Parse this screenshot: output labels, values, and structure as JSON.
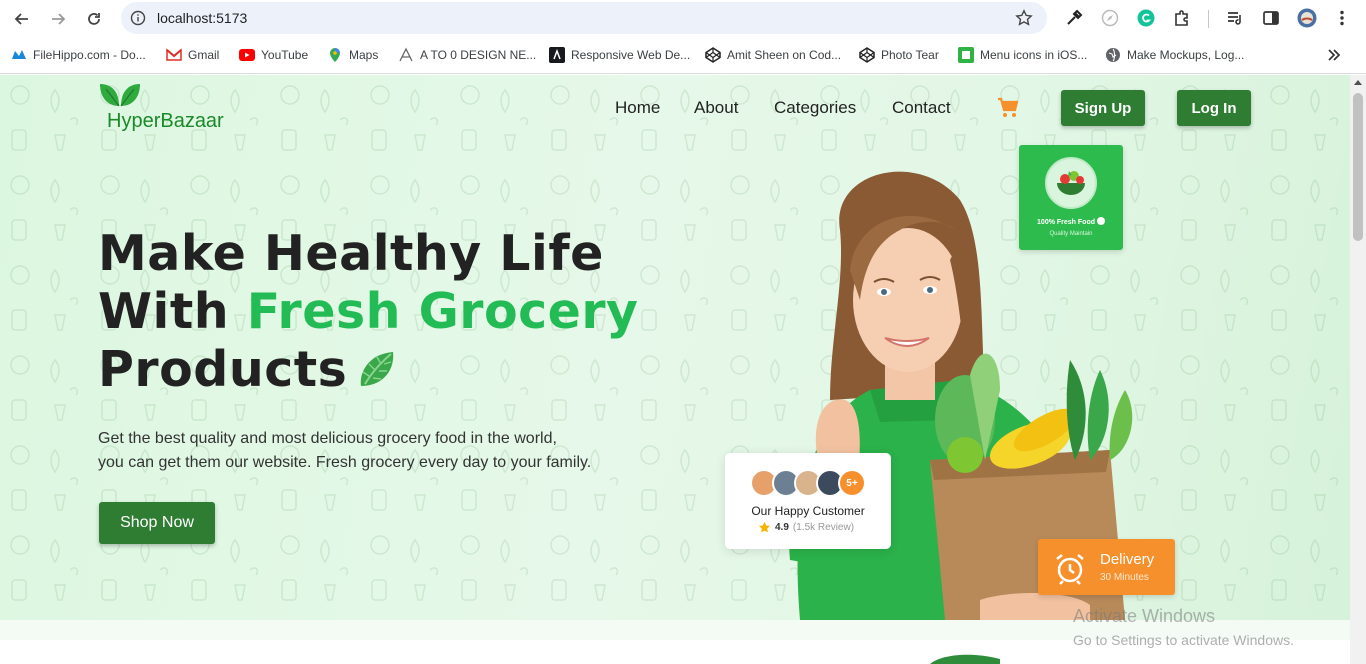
{
  "browser": {
    "url": "localhost:5173",
    "bookmarks": [
      {
        "label": "FileHippo.com - Do...",
        "icon": "filehippo-icon"
      },
      {
        "label": "Gmail",
        "icon": "gmail-icon"
      },
      {
        "label": "YouTube",
        "icon": "youtube-icon"
      },
      {
        "label": "Maps",
        "icon": "maps-icon"
      },
      {
        "label": "A TO 0 DESIGN NE...",
        "icon": "design-icon"
      },
      {
        "label": "Responsive Web De...",
        "icon": "astro-icon"
      },
      {
        "label": "Amit Sheen on Cod...",
        "icon": "codepen-icon"
      },
      {
        "label": "Photo Tear",
        "icon": "codepen-icon"
      },
      {
        "label": "Menu icons in iOS...",
        "icon": "menu-icon"
      },
      {
        "label": "Make Mockups, Log...",
        "icon": "globe-icon"
      }
    ]
  },
  "site": {
    "brand": "HyperBazaar",
    "nav": [
      "Home",
      "About",
      "Categories",
      "Contact"
    ],
    "signup_label": "Sign Up",
    "login_label": "Log In"
  },
  "hero": {
    "headline_line1": "Make Healthy Life",
    "headline_line2_prefix": "With ",
    "headline_line2_highlight": "Fresh Grocery",
    "headline_line3": "Products",
    "description_line1": "Get the best quality and most delicious grocery food in the world,",
    "description_line2": "you can get them our website. Fresh grocery every day to your family.",
    "cta_label": "Shop Now"
  },
  "badges": {
    "fresh_title": "100% Fresh Food",
    "fresh_sub": "Quality Maintain",
    "customers_count": "5+",
    "customers_title": "Our Happy Customer",
    "rating": "4.9",
    "reviews": "(1.5k Review)",
    "delivery_title": "Delivery",
    "delivery_sub": "30 Minutes"
  },
  "os_watermark": {
    "title": "Activate Windows",
    "sub": "Go to Settings to activate Windows."
  },
  "colors": {
    "brand_green": "#2e7d32",
    "highlight_green": "#22bb55",
    "accent_orange": "#f6902c"
  }
}
